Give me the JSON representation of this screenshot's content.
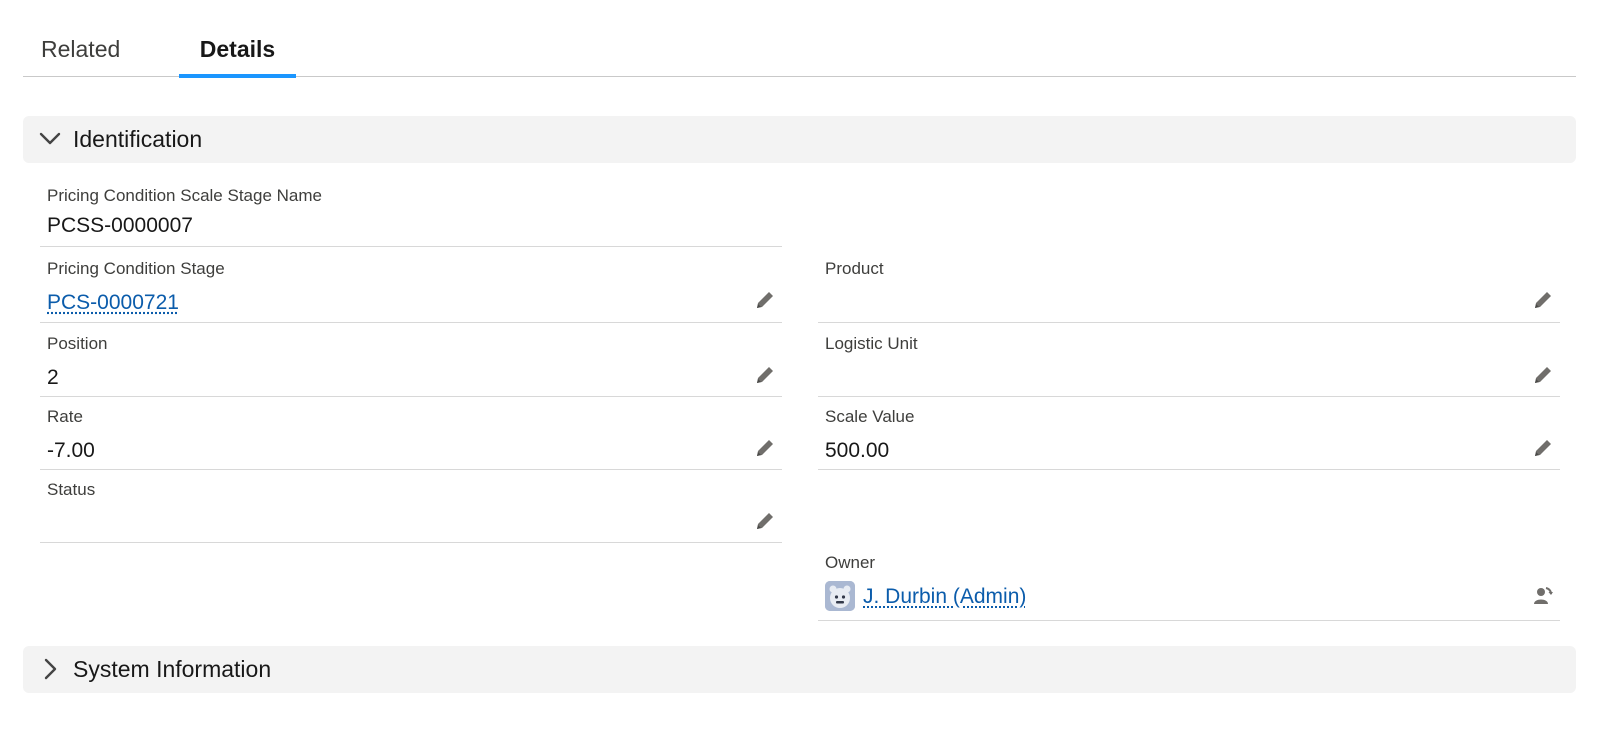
{
  "tabs": [
    {
      "label": "Related",
      "active": false
    },
    {
      "label": "Details",
      "active": true
    }
  ],
  "sections": {
    "identification": {
      "title": "Identification",
      "expanded": true
    },
    "system_information": {
      "title": "System Information",
      "expanded": false
    }
  },
  "fields": {
    "name": {
      "label": "Pricing Condition Scale Stage Name",
      "value": "PCSS-0000007"
    },
    "pricing_condition_stage": {
      "label": "Pricing Condition Stage",
      "value": "PCS-0000721"
    },
    "product": {
      "label": "Product",
      "value": ""
    },
    "position": {
      "label": "Position",
      "value": "2"
    },
    "logistic_unit": {
      "label": "Logistic Unit",
      "value": ""
    },
    "rate": {
      "label": "Rate",
      "value": "-7.00"
    },
    "scale_value": {
      "label": "Scale Value",
      "value": "500.00"
    },
    "status": {
      "label": "Status",
      "value": ""
    },
    "owner": {
      "label": "Owner",
      "value": "J. Durbin (Admin)"
    }
  },
  "icons": {
    "edit": "pencil-icon",
    "change_owner": "change-owner-icon",
    "collapse": "chevron-down-icon",
    "expand": "chevron-right-icon"
  },
  "colors": {
    "link": "#0b5cab",
    "active_tab": "#1b96ff",
    "section_bg": "#f3f3f3"
  }
}
